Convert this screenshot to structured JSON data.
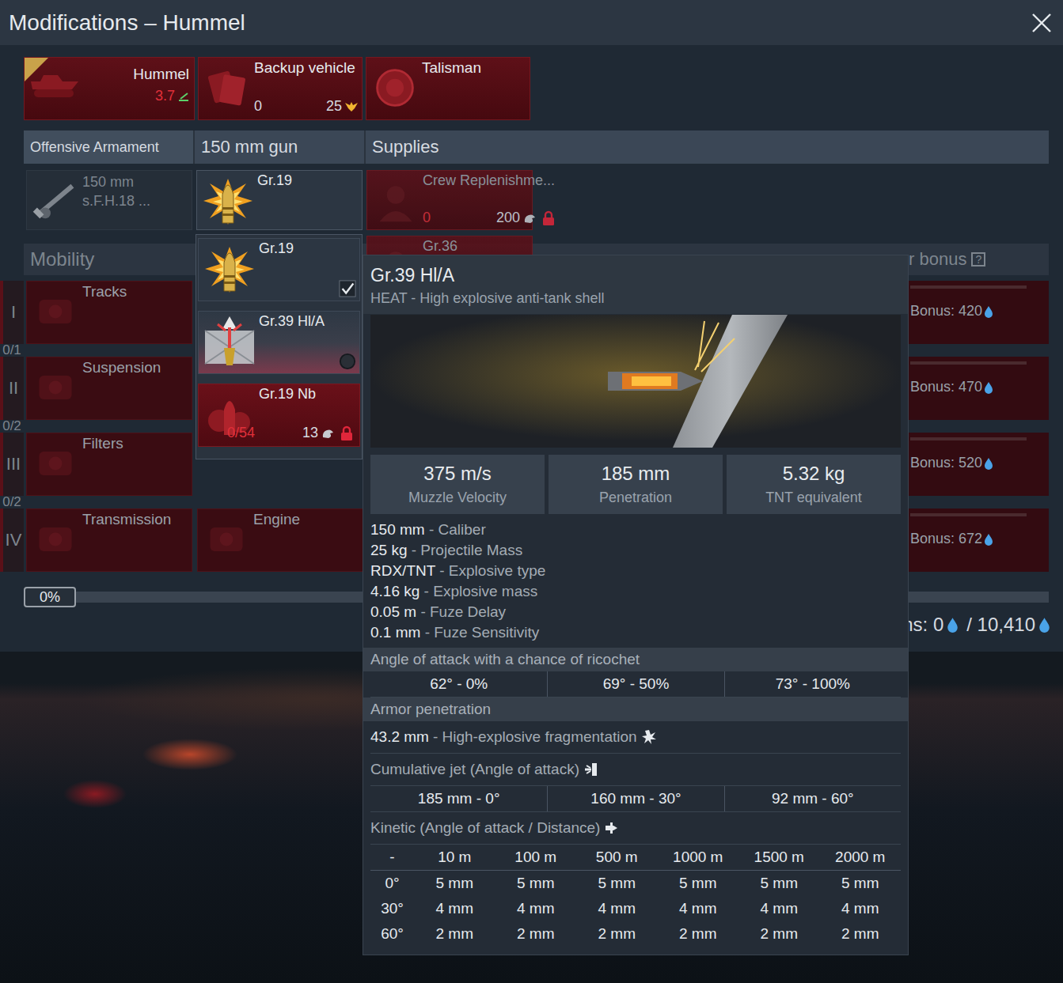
{
  "window": {
    "title": "Modifications – Hummel"
  },
  "top_cards": [
    {
      "label": "Hummel",
      "rank": "3.7"
    },
    {
      "label": "Backup vehicle",
      "count": "0",
      "cost": "25"
    },
    {
      "label": "Talisman"
    }
  ],
  "column_headers": [
    "Offensive Armament",
    "150 mm gun",
    "Supplies"
  ],
  "weapon": {
    "label": "150 mm s.F.H.18 ..."
  },
  "gun_slot": {
    "label": "Gr.19",
    "kind": "he"
  },
  "supplies": [
    {
      "label": "Crew Replenishme...",
      "count": "0",
      "cost": "200",
      "locked": true
    },
    {
      "label": "Gr.36",
      "locked": false
    }
  ],
  "mobility": {
    "title": "Mobility",
    "bonus_header": "r bonus",
    "help": "?",
    "tiers": [
      {
        "roman": "I",
        "items": [
          "Tracks"
        ],
        "bonus": "Bonus: 420",
        "progress": "0/1"
      },
      {
        "roman": "II",
        "items": [
          "Suspension"
        ],
        "bonus": "Bonus: 470",
        "progress": "0/2"
      },
      {
        "roman": "III",
        "items": [
          "Filters"
        ],
        "bonus": "Bonus: 520",
        "progress": "0/2"
      },
      {
        "roman": "IV",
        "items": [
          "Transmission",
          "Engine"
        ],
        "bonus": "Bonus: 672",
        "progress": ""
      }
    ]
  },
  "research": {
    "percent": "0%",
    "level": 0,
    "points": "ns: 0",
    "total": "/ 10,410"
  },
  "ammo_menu": [
    {
      "label": "Gr.19",
      "kind": "he",
      "checked": true,
      "hovered": false,
      "locked": false
    },
    {
      "label": "Gr.39 Hl/A",
      "kind": "heat",
      "checked": false,
      "hovered": true,
      "locked": false
    },
    {
      "label": "Gr.19 Nb",
      "kind": "smoke",
      "checked": false,
      "hovered": false,
      "locked": true,
      "progress": "0/54",
      "cost": "13"
    }
  ],
  "tooltip": {
    "title": "Gr.39 Hl/A",
    "subtitle": "HEAT - High explosive anti-tank shell",
    "stats": [
      {
        "value": "375 m/s",
        "label": "Muzzle Velocity"
      },
      {
        "value": "185 mm",
        "label": "Penetration"
      },
      {
        "value": "5.32 kg",
        "label": "TNT equivalent"
      }
    ],
    "specs": [
      {
        "value": "150 mm",
        "label": "- Caliber"
      },
      {
        "value": "25 kg",
        "label": "- Projectile Mass"
      },
      {
        "value": "RDX/TNT",
        "label": "- Explosive type"
      },
      {
        "value": "4.16 kg",
        "label": "- Explosive mass"
      },
      {
        "value": "0.05 m",
        "label": "- Fuze Delay"
      },
      {
        "value": "0.1 mm",
        "label": "- Fuze Sensitivity"
      }
    ],
    "ricochet": {
      "title": "Angle of attack with a chance of ricochet",
      "values": [
        "62° - 0%",
        "69° - 50%",
        "73° - 100%"
      ]
    },
    "armor_title": "Armor penetration",
    "he": {
      "value": "43.2 mm",
      "label": "- High-explosive fragmentation"
    },
    "jet": {
      "title": "Cumulative jet (Angle of attack)",
      "values": [
        "185 mm - 0°",
        "160 mm - 30°",
        "92 mm - 60°"
      ]
    },
    "kinetic": {
      "title": "Kinetic (Angle of attack / Distance)",
      "columns": [
        "-",
        "10 m",
        "100 m",
        "500 m",
        "1000 m",
        "1500 m",
        "2000 m"
      ],
      "rows": [
        {
          "angle": "0°",
          "values": [
            "5 mm",
            "5 mm",
            "5 mm",
            "5 mm",
            "5 mm",
            "5 mm"
          ]
        },
        {
          "angle": "30°",
          "values": [
            "4 mm",
            "4 mm",
            "4 mm",
            "4 mm",
            "4 mm",
            "4 mm"
          ]
        },
        {
          "angle": "60°",
          "values": [
            "2 mm",
            "2 mm",
            "2 mm",
            "2 mm",
            "2 mm",
            "2 mm"
          ]
        }
      ]
    }
  }
}
